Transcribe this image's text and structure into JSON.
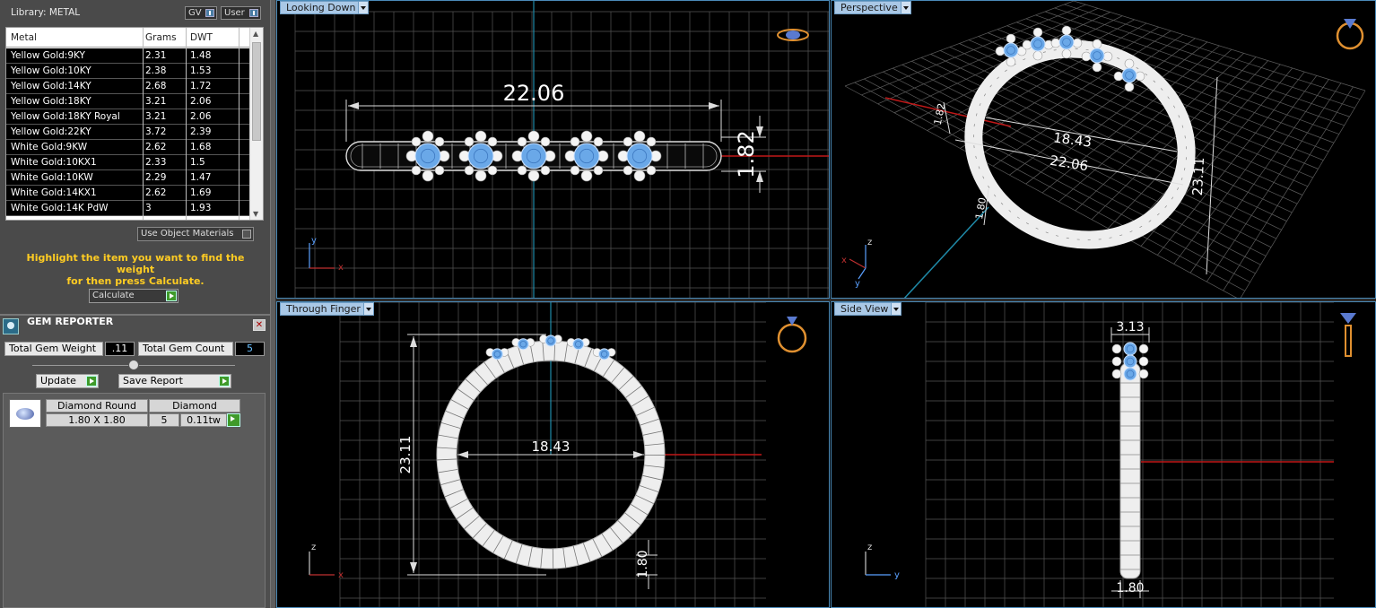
{
  "library": {
    "title": "Library: METAL",
    "toggle_gv": "GV",
    "toggle_user": "User",
    "columns": [
      "Metal",
      "Grams",
      "DWT"
    ],
    "rows": [
      [
        "Yellow Gold:9KY",
        "2.31",
        "1.48"
      ],
      [
        "Yellow Gold:10KY",
        "2.38",
        "1.53"
      ],
      [
        "Yellow Gold:14KY",
        "2.68",
        "1.72"
      ],
      [
        "Yellow Gold:18KY",
        "3.21",
        "2.06"
      ],
      [
        "Yellow Gold:18KY Royal",
        "3.21",
        "2.06"
      ],
      [
        "Yellow Gold:22KY",
        "3.72",
        "2.39"
      ],
      [
        "White Gold:9KW",
        "2.62",
        "1.68"
      ],
      [
        "White Gold:10KX1",
        "2.33",
        "1.5"
      ],
      [
        "White Gold:10KW",
        "2.29",
        "1.47"
      ],
      [
        "White Gold:14KX1",
        "2.62",
        "1.69"
      ],
      [
        "White Gold:14K PdW",
        "3",
        "1.93"
      ]
    ],
    "use_object_materials": "Use Object Materials",
    "hint_line1": "Highlight the item you want to find the weight",
    "hint_line2": "for then press Calculate.",
    "calculate": "Calculate"
  },
  "gem_reporter": {
    "title": "GEM REPORTER",
    "total_weight_label": "Total Gem Weight",
    "total_weight_value": ".11",
    "total_count_label": "Total Gem Count",
    "total_count_value": "5",
    "update": "Update",
    "save_report": "Save Report",
    "gems": [
      {
        "shape": "Diamond Round",
        "type": "Diamond",
        "size": "1.80 X 1.80",
        "count": "5",
        "weight": "0.11tw"
      }
    ]
  },
  "viewports": {
    "looking_down": {
      "label": "Looking Down",
      "width_dim": "22.06",
      "height_dim": "1.82"
    },
    "perspective": {
      "label": "Perspective",
      "dim_a": "18.43",
      "dim_b": "22.06",
      "dim_c": "23.11",
      "dim_d": "1.82",
      "dim_e": "1.80"
    },
    "through_finger": {
      "label": "Through Finger",
      "inner_dim": "18.43",
      "height_dim": "23.11",
      "band_dim": "1.80"
    },
    "side_view": {
      "label": "Side View",
      "top_dim": "3.13",
      "bottom_dim": "1.80"
    }
  },
  "axes": {
    "x": "x",
    "y": "y",
    "z": "z"
  },
  "colors": {
    "grid": "#5a5a5a",
    "gem_blue": "#6aa8e8",
    "axis_red": "#c01818",
    "axis_teal": "#1f8aa8",
    "hint_yellow": "#ffcc22"
  }
}
